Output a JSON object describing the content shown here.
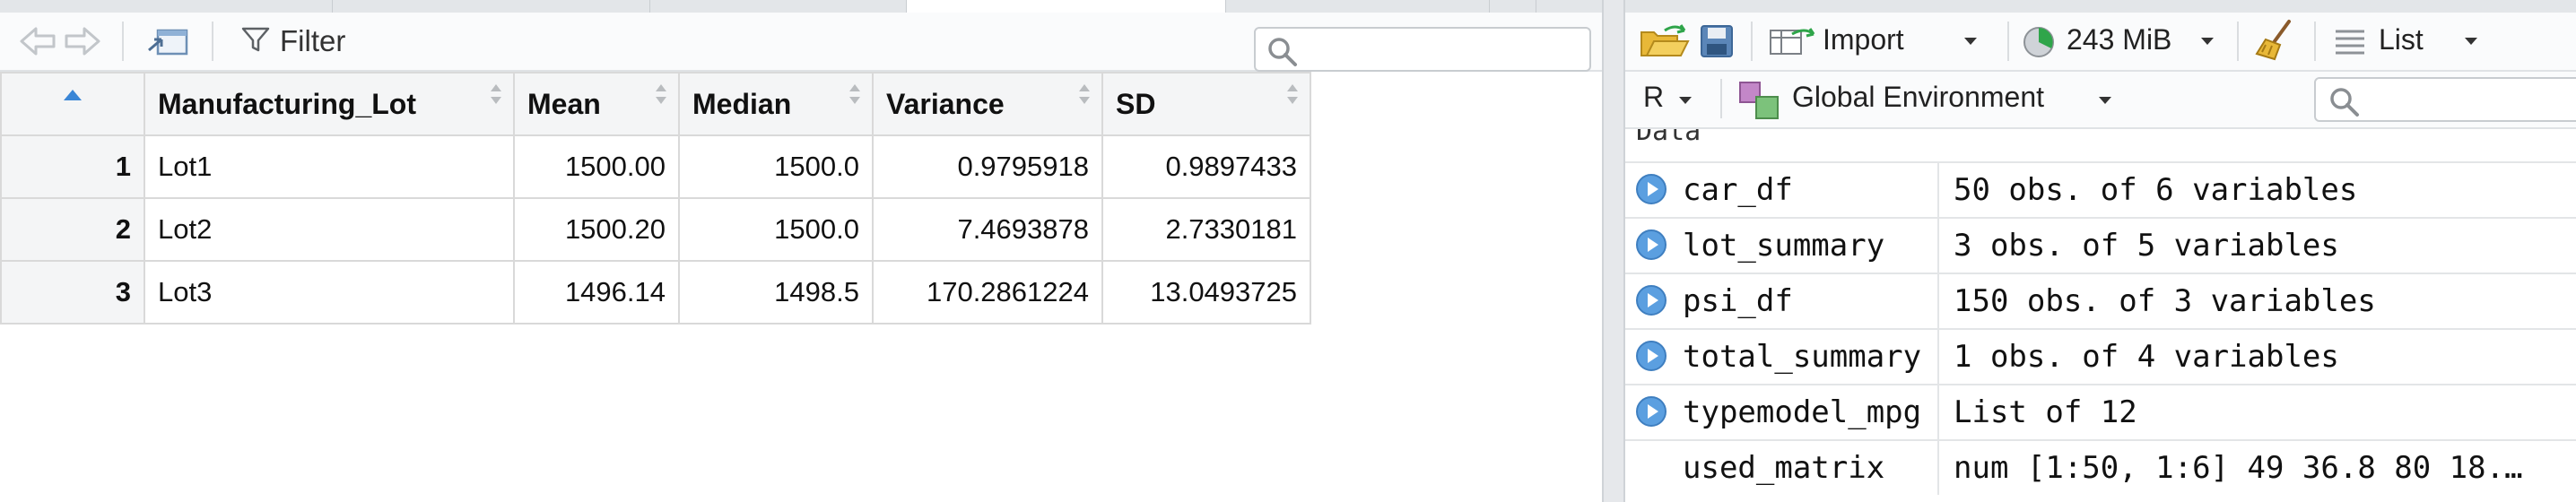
{
  "viewer": {
    "filter_label": "Filter",
    "search": {
      "value": "",
      "placeholder": ""
    },
    "table": {
      "columns": [
        "Manufacturing_Lot",
        "Mean",
        "Median",
        "Variance",
        "SD"
      ],
      "rows": [
        {
          "index": "1",
          "Manufacturing_Lot": "Lot1",
          "Mean": "1500.00",
          "Median": "1500.0",
          "Variance": "0.9795918",
          "SD": "0.9897433"
        },
        {
          "index": "2",
          "Manufacturing_Lot": "Lot2",
          "Mean": "1500.20",
          "Median": "1500.0",
          "Variance": "7.4693878",
          "SD": "2.7330181"
        },
        {
          "index": "3",
          "Manufacturing_Lot": "Lot3",
          "Mean": "1496.14",
          "Median": "1498.5",
          "Variance": "170.2861224",
          "SD": "13.0493725"
        }
      ]
    }
  },
  "environment": {
    "toolbar": {
      "import_label": "Import",
      "memory_label": "243 MiB",
      "view_mode_label": "List"
    },
    "language_label": "R",
    "scope_label": "Global Environment",
    "search": {
      "value": "",
      "placeholder": ""
    },
    "section_header": "Data",
    "objects": [
      {
        "name": "car_df",
        "value": "50 obs. of 6 variables",
        "expandable": true
      },
      {
        "name": "lot_summary",
        "value": "3 obs. of 5 variables",
        "expandable": true
      },
      {
        "name": "psi_df",
        "value": "150 obs. of 3 variables",
        "expandable": true
      },
      {
        "name": "total_summary",
        "value": "1 obs. of 4 variables",
        "expandable": true
      },
      {
        "name": "typemodel_mpg",
        "value": "List of  12",
        "expandable": true
      },
      {
        "name": "used_matrix",
        "value": "num [1:50, 1:6] 49 36.8 80 18.…",
        "expandable": false
      }
    ]
  },
  "colors": {
    "accent_blue": "#5b9fe0",
    "sort_indicator": "#3a86d6",
    "header_bg": "#f4f5f6",
    "grid_line": "#d9d9d9",
    "import_arrow": "#2fa54a",
    "folder": "#e8b838"
  },
  "icons": {
    "back": "arrow-left-icon",
    "forward": "arrow-right-icon",
    "popout": "popout-icon",
    "filter": "funnel-icon",
    "search": "magnifier-icon",
    "open": "open-folder-icon",
    "save": "floppy-disk-icon",
    "import": "import-dataset-icon",
    "memory": "pie-chart-icon",
    "clear": "broom-icon",
    "list": "list-lines-icon",
    "environment": "environment-cubes-icon"
  }
}
